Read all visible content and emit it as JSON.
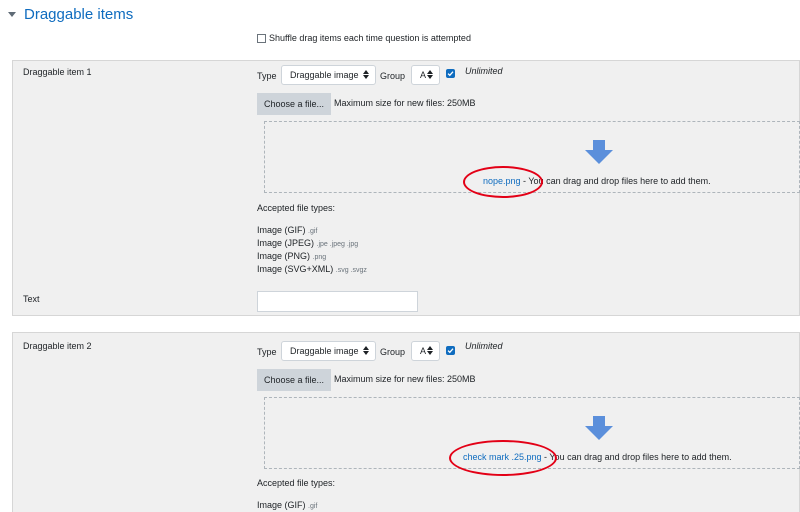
{
  "section": {
    "title": "Draggable items"
  },
  "shuffle": {
    "label": "Shuffle drag items each time question is attempted",
    "checked": false
  },
  "items": [
    {
      "label": "Draggable item 1",
      "type_label": "Type",
      "type_value": "Draggable image",
      "group_label": "Group",
      "group_value": "A",
      "unlimited_label": "Unlimited",
      "unlimited_checked": true,
      "choose_label": "Choose a file...",
      "max_size": "Maximum size for new files: 250MB",
      "file_name": "nope.png",
      "drop_hint": " - You can drag and drop files here to add them.",
      "accepted_label": "Accepted file types:",
      "file_types": [
        {
          "name": "Image (GIF)",
          "ext": ".gif"
        },
        {
          "name": "Image (JPEG)",
          "ext": ".jpe .jpeg .jpg"
        },
        {
          "name": "Image (PNG)",
          "ext": ".png"
        },
        {
          "name": "Image (SVG+XML)",
          "ext": ".svg .svgz"
        }
      ],
      "text_label": "Text",
      "text_value": ""
    },
    {
      "label": "Draggable item 2",
      "type_label": "Type",
      "type_value": "Draggable image",
      "group_label": "Group",
      "group_value": "A",
      "unlimited_label": "Unlimited",
      "unlimited_checked": true,
      "choose_label": "Choose a file...",
      "max_size": "Maximum size for new files: 250MB",
      "file_name": "check mark .25.png",
      "drop_hint": " - You can drag and drop files here to add them.",
      "accepted_label": "Accepted file types:",
      "file_types": [
        {
          "name": "Image (GIF)",
          "ext": ".gif"
        }
      ]
    }
  ],
  "colors": {
    "link": "#0f6cbf",
    "highlight": "#e30016",
    "panel": "#f0f0f0",
    "arrow": "#5b8fdb"
  },
  "icons": {
    "collapse": "chevron-down-icon",
    "drop": "arrow-down-icon",
    "check": "check-icon"
  }
}
